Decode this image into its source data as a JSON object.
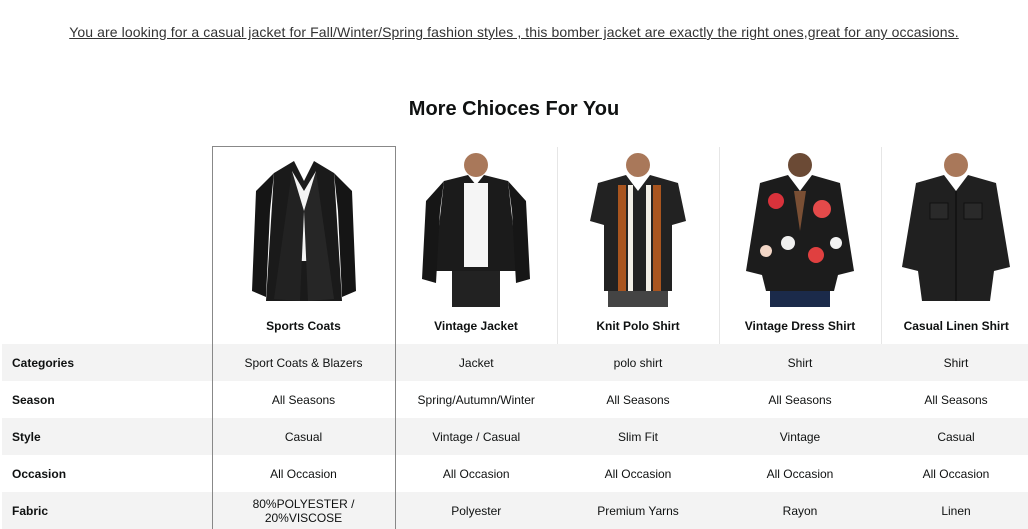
{
  "tagline": "You are looking for a casual jacket for Fall/Winter/Spring fashion styles , this bomber jacket are exactly the right ones,great for any occasions.",
  "section_title": "More Chioces For You",
  "products": [
    {
      "name": "Sports Coats",
      "image": "sports-coat-image",
      "categories": "Sport Coats & Blazers",
      "season": "All Seasons",
      "style": "Casual",
      "occasion": "All Occasion",
      "fabric": "80%POLYESTER / 20%VISCOSE"
    },
    {
      "name": "Vintage Jacket",
      "image": "vintage-jacket-image",
      "categories": "Jacket",
      "season": "Spring/Autumn/Winter",
      "style": "Vintage / Casual",
      "occasion": "All Occasion",
      "fabric": "Polyester"
    },
    {
      "name": "Knit Polo Shirt",
      "image": "knit-polo-shirt-image",
      "categories": "polo shirt",
      "season": "All Seasons",
      "style": "Slim Fit",
      "occasion": "All Occasion",
      "fabric": "Premium Yarns"
    },
    {
      "name": "Vintage Dress Shirt",
      "image": "vintage-dress-shirt-image",
      "categories": "Shirt",
      "season": "All Seasons",
      "style": "Vintage",
      "occasion": "All Occasion",
      "fabric": "Rayon"
    },
    {
      "name": "Casual Linen Shirt",
      "image": "casual-linen-shirt-image",
      "categories": "Shirt",
      "season": "All Seasons",
      "style": "Casual",
      "occasion": "All Occasion",
      "fabric": "Linen"
    }
  ],
  "row_labels": {
    "categories": "Categories",
    "season": "Season",
    "style": "Style",
    "occasion": "Occasion",
    "fabric": "Fabric"
  }
}
